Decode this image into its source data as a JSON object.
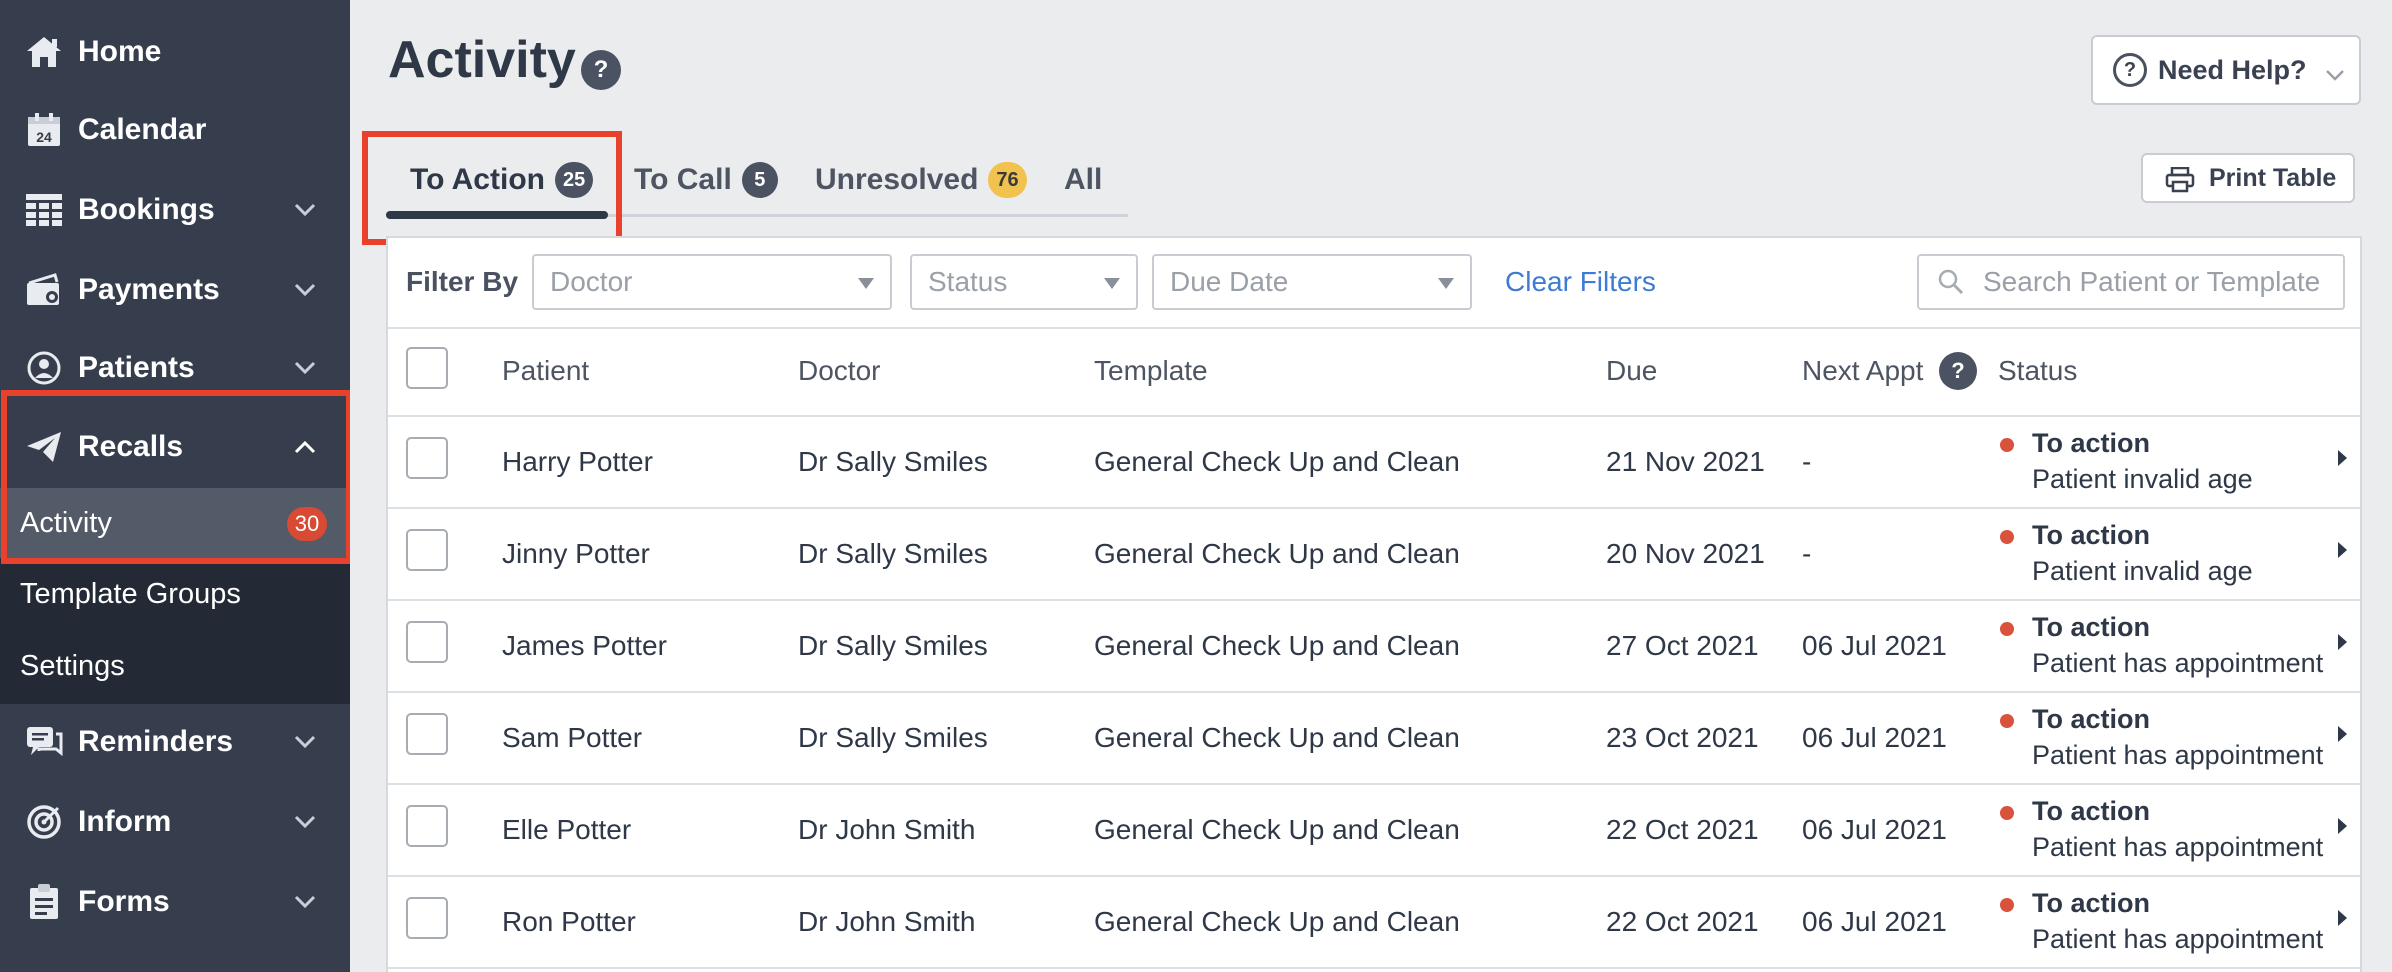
{
  "sidebar": {
    "items": [
      {
        "label": "Home",
        "icon": "home-icon"
      },
      {
        "label": "Calendar",
        "icon": "calendar-icon",
        "icon_text": "24"
      },
      {
        "label": "Bookings",
        "icon": "grid-icon"
      },
      {
        "label": "Payments",
        "icon": "wallet-icon"
      },
      {
        "label": "Patients",
        "icon": "user-circle-icon"
      },
      {
        "label": "Recalls",
        "icon": "paper-plane-icon"
      }
    ],
    "recalls_sub": [
      {
        "label": "Activity",
        "badge": "30"
      },
      {
        "label": "Template Groups"
      },
      {
        "label": "Settings"
      }
    ],
    "items_bottom": [
      {
        "label": "Reminders",
        "icon": "chat-icon"
      },
      {
        "label": "Inform",
        "icon": "target-icon"
      },
      {
        "label": "Forms",
        "icon": "clipboard-icon"
      }
    ]
  },
  "header": {
    "title": "Activity",
    "help_symbol": "?",
    "need_help": "Need Help?"
  },
  "tabs": [
    {
      "label": "To Action",
      "count": "25"
    },
    {
      "label": "To Call",
      "count": "5"
    },
    {
      "label": "Unresolved",
      "count": "76"
    },
    {
      "label": "All"
    }
  ],
  "toolbar": {
    "print_label": "Print Table"
  },
  "filters": {
    "label": "Filter By",
    "doctor_placeholder": "Doctor",
    "status_placeholder": "Status",
    "due_date_placeholder": "Due Date",
    "clear_label": "Clear Filters",
    "search_placeholder": "Search Patient or Template"
  },
  "table": {
    "columns": {
      "patient": "Patient",
      "doctor": "Doctor",
      "template": "Template",
      "due": "Due",
      "next_appt": "Next Appt",
      "status": "Status"
    },
    "rows": [
      {
        "patient": "Harry Potter",
        "doctor": "Dr Sally Smiles",
        "template": "General Check Up and Clean",
        "due": "21 Nov 2021",
        "next_appt": "-",
        "status": "To action",
        "status_detail": "Patient invalid age"
      },
      {
        "patient": "Jinny Potter",
        "doctor": "Dr Sally Smiles",
        "template": "General Check Up and Clean",
        "due": "20 Nov 2021",
        "next_appt": "-",
        "status": "To action",
        "status_detail": "Patient invalid age"
      },
      {
        "patient": "James Potter",
        "doctor": "Dr Sally Smiles",
        "template": "General Check Up and Clean",
        "due": "27 Oct 2021",
        "next_appt": "06 Jul 2021",
        "status": "To action",
        "status_detail": "Patient has appointment"
      },
      {
        "patient": "Sam Potter",
        "doctor": "Dr Sally Smiles",
        "template": "General Check Up and Clean",
        "due": "23 Oct 2021",
        "next_appt": "06 Jul 2021",
        "status": "To action",
        "status_detail": "Patient has appointment"
      },
      {
        "patient": "Elle Potter",
        "doctor": "Dr John Smith",
        "template": "General Check Up and Clean",
        "due": "22 Oct 2021",
        "next_appt": "06 Jul 2021",
        "status": "To action",
        "status_detail": "Patient has appointment"
      },
      {
        "patient": "Ron Potter",
        "doctor": "Dr John Smith",
        "template": "General Check Up and Clean",
        "due": "22 Oct 2021",
        "next_appt": "06 Jul 2021",
        "status": "To action",
        "status_detail": "Patient has appointment"
      }
    ]
  },
  "colors": {
    "sidebar_bg": "#363e4d",
    "highlight": "#e8412c",
    "link": "#3d7bd4",
    "status_dot": "#d9523c",
    "badge_yellow": "#f2c24e"
  }
}
